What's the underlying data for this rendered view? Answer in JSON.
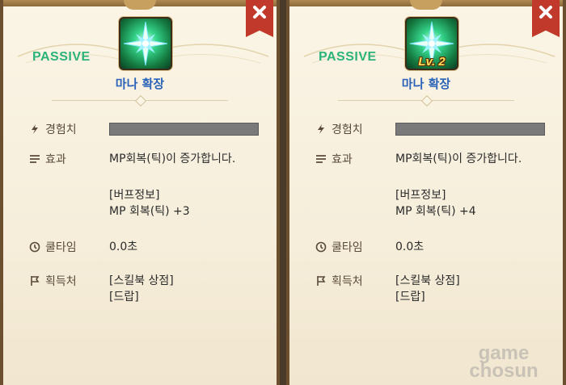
{
  "panels": [
    {
      "type_label": "PASSIVE",
      "level_badge": "",
      "skill_name": "마나 확장",
      "rows": {
        "exp_label": "경험치",
        "effect_label": "효과",
        "effect_text": "MP회복(틱)이 증가합니다.",
        "buff_title": "[버프정보]",
        "buff_value": "MP 회복(틱) +3",
        "cooldown_label": "쿨타임",
        "cooldown_value": "0.0초",
        "source_label": "획득처",
        "source_1": "[스킬북 상점]",
        "source_2": "[드랍]"
      }
    },
    {
      "type_label": "PASSIVE",
      "level_badge": "Lv. 2",
      "skill_name": "마나 확장",
      "rows": {
        "exp_label": "경험치",
        "effect_label": "효과",
        "effect_text": "MP회복(틱)이 증가합니다.",
        "buff_title": "[버프정보]",
        "buff_value": "MP 회복(틱) +4",
        "cooldown_label": "쿨타임",
        "cooldown_value": "0.0초",
        "source_label": "획득처",
        "source_1": "[스킬북 상점]",
        "source_2": "[드랍]"
      }
    }
  ],
  "watermark": {
    "line1": "game",
    "line2": "chosun"
  },
  "colors": {
    "passive": "#2bb37a",
    "skill_name": "#2a63b8",
    "close_button": "#c0392b",
    "exp_bar": "#7a7a7a"
  }
}
